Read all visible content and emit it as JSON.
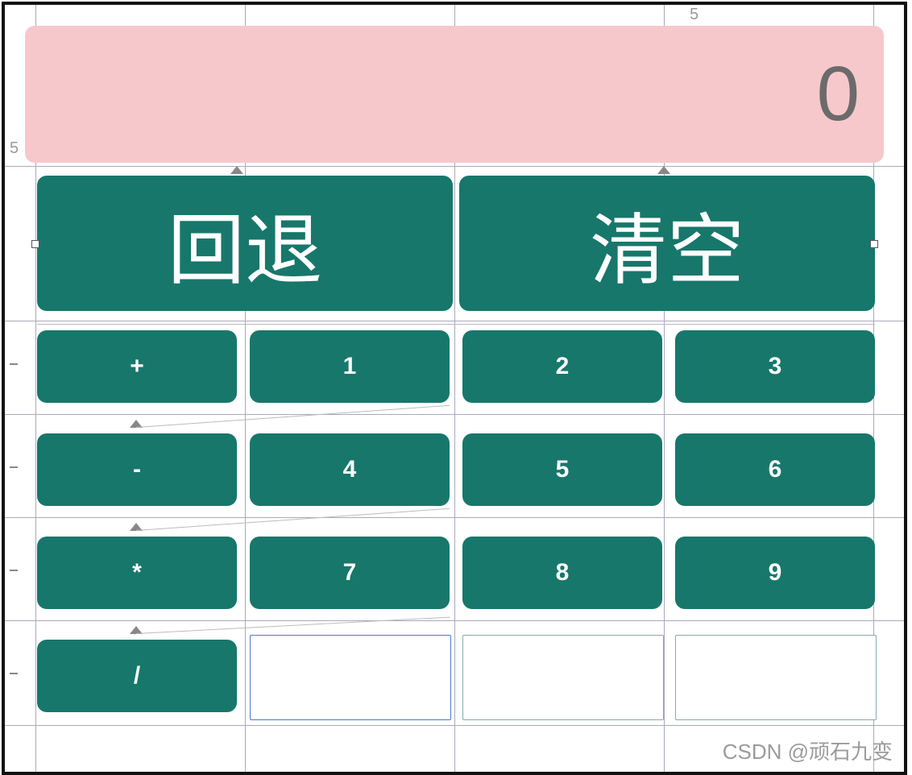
{
  "editor": {
    "tick_top": "5",
    "tick_left": "5"
  },
  "display": {
    "value": "0"
  },
  "buttons": {
    "back": "回退",
    "clear": "清空",
    "plus": "+",
    "minus": "-",
    "mul": "*",
    "div": "/",
    "k1": "1",
    "k2": "2",
    "k3": "3",
    "k4": "4",
    "k5": "5",
    "k6": "6",
    "k7": "7",
    "k8": "8",
    "k9": "9"
  },
  "watermark": "CSDN @顽石九变"
}
